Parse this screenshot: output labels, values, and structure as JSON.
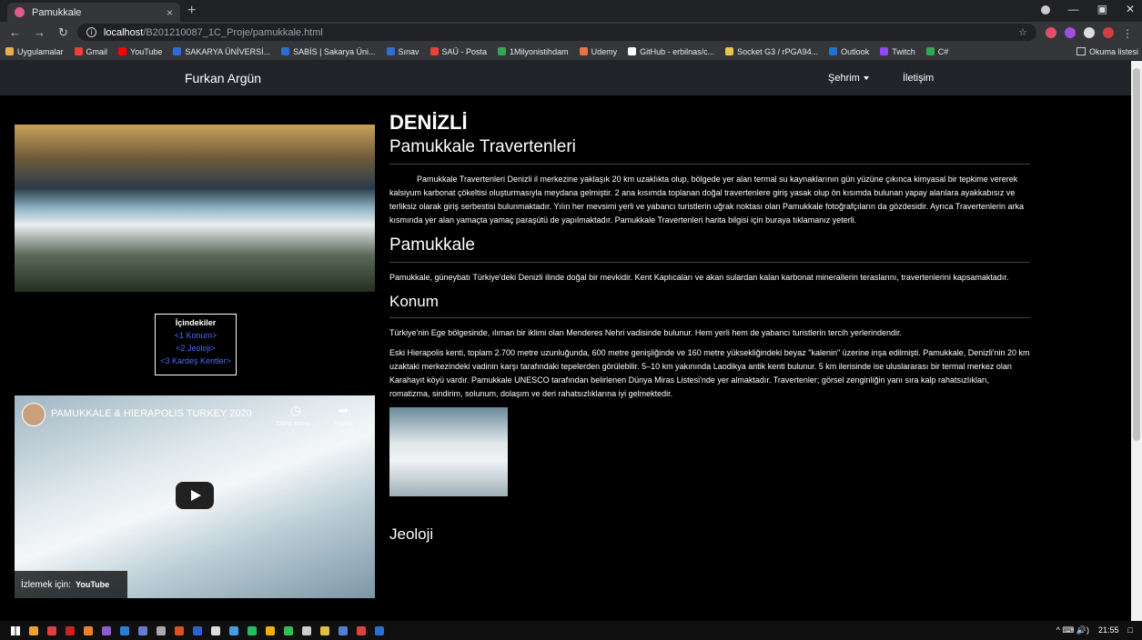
{
  "browser": {
    "tab_title": "Pamukkale",
    "tab_close": "×",
    "new_tab": "+",
    "url_host": "localhost",
    "url_path": "/B201210087_1C_Proje/pamukkale.html",
    "bookmarks": [
      {
        "label": "Uygulamalar",
        "color": "#e8b04a"
      },
      {
        "label": "Gmail",
        "color": "#ea4335"
      },
      {
        "label": "YouTube",
        "color": "#ff0000"
      },
      {
        "label": "SAKARYA ÜNİVERSİ...",
        "color": "#2c6fd1"
      },
      {
        "label": "SABİS | Sakarya Üni...",
        "color": "#2c6fd1"
      },
      {
        "label": "Sınav",
        "color": "#2c6fd1"
      },
      {
        "label": "SAÜ - Posta",
        "color": "#ea4335"
      },
      {
        "label": "1Milyonistihdam",
        "color": "#33a852"
      },
      {
        "label": "Udemy",
        "color": "#e8734a"
      },
      {
        "label": "GitHub - erbilnas/c...",
        "color": "#ffffff"
      },
      {
        "label": "Socket G3 / rPGA94...",
        "color": "#e8c44a"
      },
      {
        "label": "Outlook",
        "color": "#1e72d0"
      },
      {
        "label": "Twitch",
        "color": "#9146ff"
      },
      {
        "label": "C#",
        "color": "#33a852"
      }
    ],
    "reading_list": "Okuma listesi"
  },
  "site": {
    "brand": "Furkan Argün",
    "nav_city": "Şehrim",
    "nav_contact": "İletişim"
  },
  "toc": {
    "heading": "İçindekiler",
    "items": [
      "<1 Konum>",
      "<2 Jeoloji>",
      "<3 Kardeş Kentler>"
    ]
  },
  "video": {
    "title": "PAMUKKALE & HIERAPOLIS TURKEY 2020",
    "later": "Daha sonra...",
    "share": "Paylaş",
    "watch_on": "İzlemek için:",
    "yt": "YouTube"
  },
  "article": {
    "h1": "DENİZLİ",
    "h2_trav": "Pamukkale Travertenleri",
    "p_trav": "Pamukkale Travertenleri Denizli il merkezine yaklaşık 20 km uzaklıkta olup, bölgede yer alan termal su kaynaklarının gün yüzüne çıkınca kimyasal bir tepkime vererek kalsiyum karbonat çökeltisi oluşturmasıyla meydana gelmiştir. 2 ana kısımda toplanan doğal travertenlere giriş yasak olup ön kısımda bulunan yapay alanlara ayakkabısız ve terliksiz olarak giriş serbestisi bulunmaktadır. Yılın her mevsimi yerli ve yabancı turistlerin uğrak noktası olan Pamukkale fotoğrafçıların da gözdesidir. Ayrıca Travertenlerin arka kısmında yer alan yamaçta yamaç paraşütü de yapılmaktadır. Pamukkale Travertenleri harita bilgisi için buraya tıklamanız yeterli.",
    "h2_pam": "Pamukkale",
    "p_pam": "Pamukkale, güneybatı Türkiye'deki Denizli ilinde doğal bir mevkidir. Kent Kaplıcaları ve akan sulardan kalan karbonat minerallerin teraslarını, travertenlerini kapsamaktadır.",
    "h3_konum": "Konum",
    "p_konum1": "Türkiye'nin Ege bölgesinde, ılıman bir iklimi olan Menderes Nehri vadisinde bulunur. Hem yerli hem de yabancı turistlerin tercih yerlerindendir.",
    "p_konum2": "Eski Hierapolis kenti, toplam 2.700 metre uzunluğunda, 600 metre genişliğinde ve 160 metre yüksekliğindeki beyaz \"kalenin\" üzerine inşa edilmişti. Pamukkale, Denizli'nin 20 km uzaktaki merkezindeki vadinin karşı tarafındaki tepelerden görülebilir. 5–10 km yakınında Laodikya antik kenti bulunur. 5 km ilerisinde ise uluslararası bir termal merkez olan Karahayıt köyü vardır. Pamukkale UNESCO tarafından belirlenen Dünya Miras Listesi'nde yer almaktadır. Travertenler; görsel zenginliğin yanı sıra kalp rahatsızlıkları, romatizma, sindirim, solunum, dolaşım ve deri rahatsızlıklarına iyi gelmektedir.",
    "h3_jeoloji": "Jeoloji"
  },
  "taskbar": {
    "time": "21:55",
    "tray": "^ ⌨ 🔊)",
    "icon_colors": [
      "#f0a030",
      "#e04040",
      "#d02020",
      "#f08030",
      "#8a5cd0",
      "#2a80d0",
      "#6a7ad0",
      "#aaaaaa",
      "#e05020",
      "#3060d0",
      "#dddddd",
      "#40a0e0",
      "#20c060",
      "#f0b000",
      "#30c050",
      "#cccccc",
      "#e0c040",
      "#5080d0",
      "#e04040",
      "#2a6fd0"
    ]
  }
}
